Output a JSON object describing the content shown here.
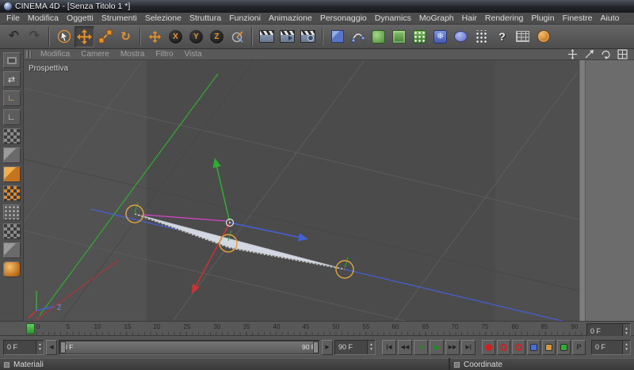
{
  "window": {
    "title": "CINEMA 4D - [Senza Titolo 1 *]"
  },
  "menubar": {
    "items": [
      "File",
      "Modifica",
      "Oggetti",
      "Strumenti",
      "Selezione",
      "Struttura",
      "Funzioni",
      "Animazione",
      "Personaggio",
      "Dynamics",
      "MoGraph",
      "Hair",
      "Rendering",
      "Plugin",
      "Finestre",
      "Aiuto"
    ]
  },
  "toolbar": {
    "axis_buttons": [
      "X",
      "Y",
      "Z"
    ]
  },
  "icons": {
    "undo": "↶",
    "redo": "↷",
    "rotate_tool": "↻",
    "deformer_snowflake": "❄",
    "help": "?",
    "convert_arrows": "⇄",
    "axis_corner": "∟",
    "goto_start": "|◀",
    "fast_back": "◀◀",
    "step_back": "◀",
    "play": "▶",
    "fast_fwd": "▶▶",
    "goto_end": "▶|",
    "spinner_up": "▲",
    "spinner_down": "▼",
    "arrow_left": "◀",
    "arrow_right": "▶"
  },
  "viewport": {
    "menu": [
      "Modifica",
      "Camere",
      "Mostra",
      "Filtro",
      "Vista"
    ],
    "camera_label": "Prospettiva",
    "world_axis_z": "Z"
  },
  "timeline": {
    "ticks": [
      "0",
      "5",
      "10",
      "15",
      "20",
      "25",
      "30",
      "35",
      "40",
      "45",
      "50",
      "55",
      "60",
      "65",
      "70",
      "75",
      "80",
      "85",
      "90"
    ],
    "ruler_frame_field": "0 F",
    "start_field": "0 F",
    "slider_start_label": "0 F",
    "slider_end_label": "90 F",
    "end_field": "90 F",
    "current_frame_field": "0 F",
    "pla_label": "P"
  },
  "panels": {
    "materials_title": "Materiali",
    "coordinates_title": "Coordinate"
  },
  "colors": {
    "accent_orange": "#e8912a",
    "axis_x_red": "#cc3333",
    "axis_y_green": "#2fae2f",
    "axis_z_blue": "#4560d8",
    "selection_orange": "#dba23e",
    "frame_marker_green": "#4db84d"
  }
}
